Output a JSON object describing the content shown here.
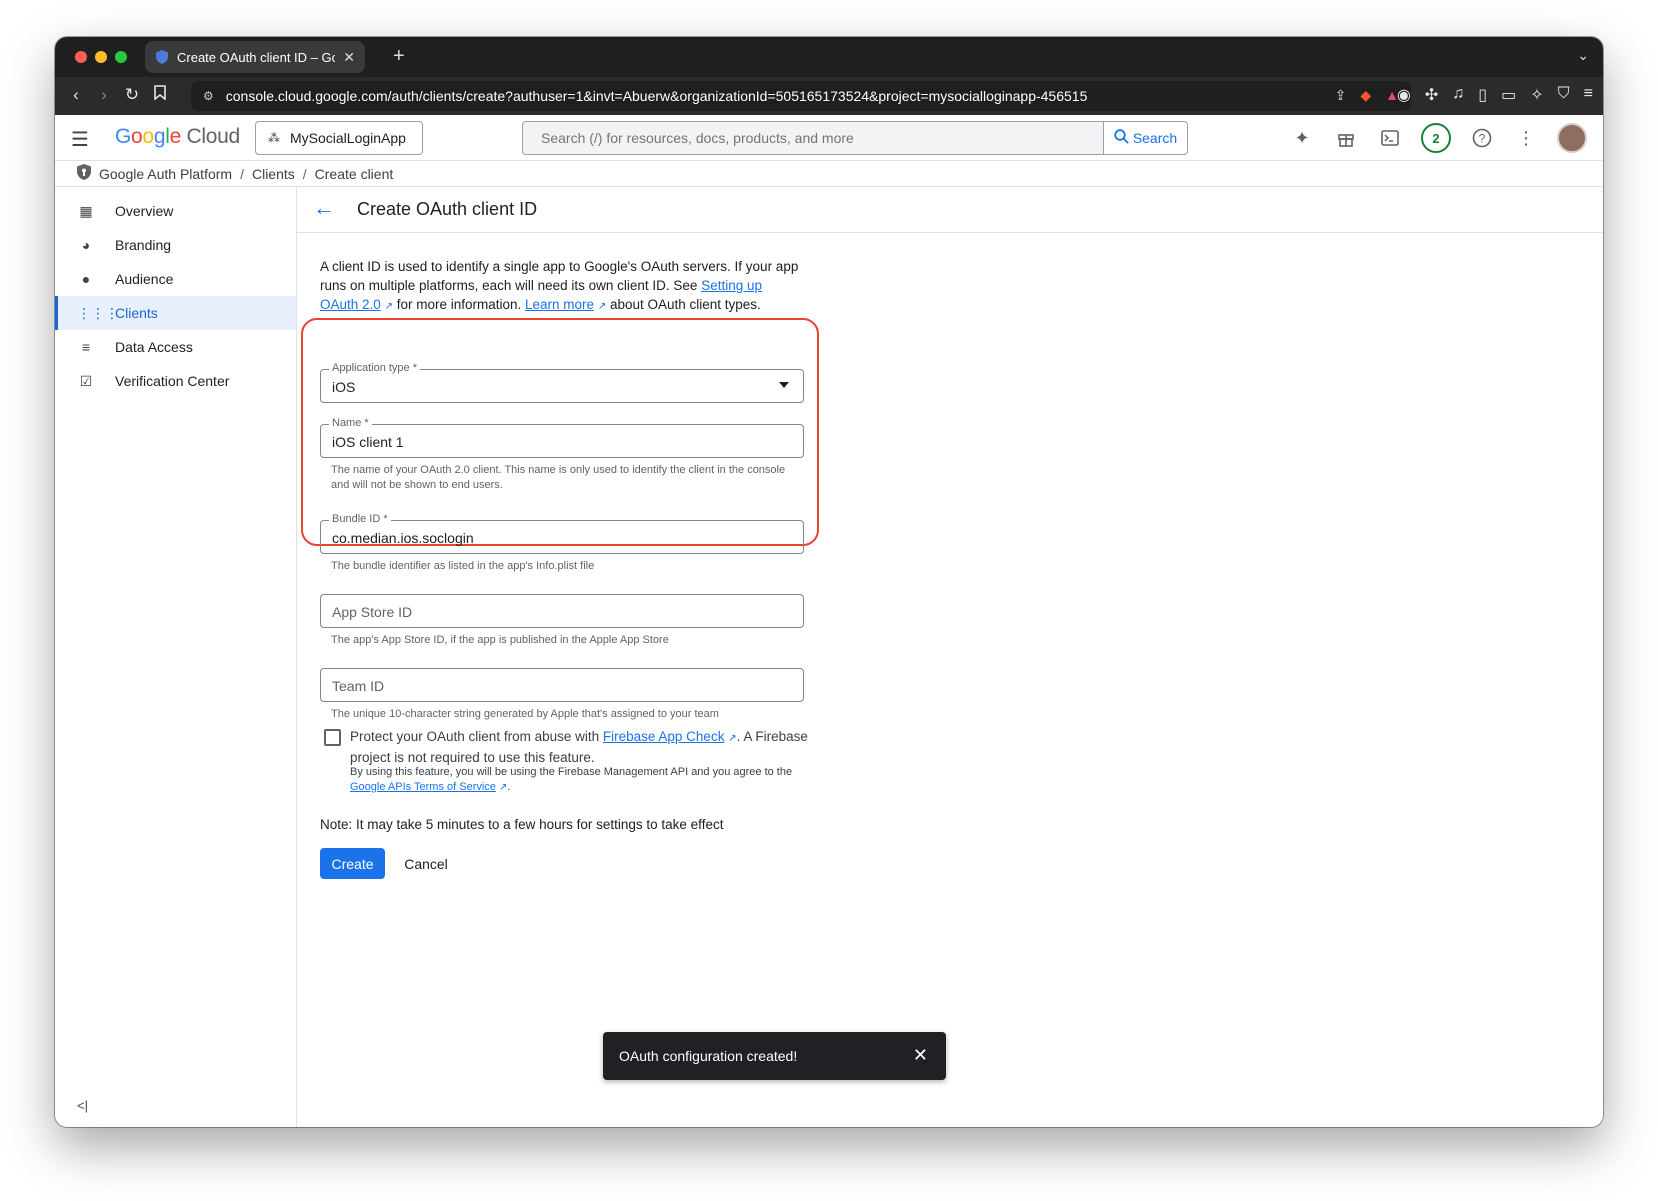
{
  "browser": {
    "tab_title": "Create OAuth client ID – Goo",
    "url": "console.cloud.google.com/auth/clients/create?authuser=1&invt=Abuerw&organizationId=505165173524&project=mysocialloginapp-456515"
  },
  "header": {
    "logo_google": "Google",
    "logo_cloud": "Cloud",
    "project": "MySocialLoginApp",
    "search_placeholder": "Search (/) for resources, docs, products, and more",
    "search_button": "Search",
    "notification_count": "2"
  },
  "breadcrumb": [
    "Google Auth Platform",
    "Clients",
    "Create client"
  ],
  "sidebar": {
    "items": [
      {
        "label": "Overview",
        "icon": "dashboard-icon"
      },
      {
        "label": "Branding",
        "icon": "palette-icon"
      },
      {
        "label": "Audience",
        "icon": "person-icon"
      },
      {
        "label": "Clients",
        "icon": "grid-icon"
      },
      {
        "label": "Data Access",
        "icon": "data-access-icon"
      },
      {
        "label": "Verification Center",
        "icon": "verified-icon"
      }
    ],
    "active": "Clients"
  },
  "main": {
    "title": "Create OAuth client ID",
    "intro_1": "A client ID is used to identify a single app to Google's OAuth servers. If your app runs on multiple platforms, each will need its own client ID. See ",
    "intro_link1": "Setting up OAuth 2.0",
    "intro_2": " for more information. ",
    "intro_link2": "Learn more",
    "intro_3": " about OAuth client types.",
    "app_type_label": "Application type *",
    "app_type_value": "iOS",
    "name_label": "Name *",
    "name_value": "iOS client 1",
    "name_help": "The name of your OAuth 2.0 client. This name is only used to identify the client in the console and will not be shown to end users.",
    "bundle_label": "Bundle ID *",
    "bundle_value": "co.median.ios.soclogin",
    "bundle_help": "The bundle identifier as listed in the app's Info.plist file",
    "appstore_placeholder": "App Store ID",
    "appstore_help": "The app's App Store ID, if the app is published in the Apple App Store",
    "team_placeholder": "Team ID",
    "team_help": "The unique 10-character string generated by Apple that's assigned to your team",
    "check_text_1": "Protect your OAuth client from abuse with ",
    "check_link": "Firebase App Check",
    "check_text_2": ". A Firebase project is not required to use this feature.",
    "check_sub_1": "By using this feature, you will be using the Firebase Management API and you agree to the ",
    "check_sub_link": "Google APIs Terms of Service",
    "check_sub_2": ".",
    "note": "Note: It may take 5 minutes to a few hours for settings to take effect",
    "create_label": "Create",
    "cancel_label": "Cancel"
  },
  "toast": {
    "message": "OAuth configuration created!"
  },
  "colors": {
    "accent": "#1a73e8",
    "highlight": "#e8452c"
  }
}
